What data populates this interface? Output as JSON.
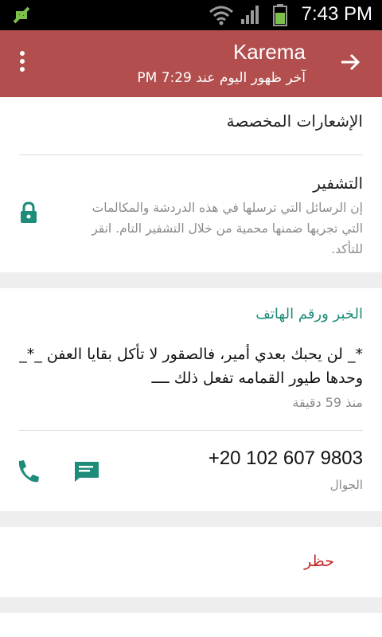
{
  "status_bar": {
    "time": "7:43 PM"
  },
  "header": {
    "name": "Karema",
    "last_seen": "آخر ظهور اليوم عند 7:29 PM"
  },
  "settings": {
    "custom_notifications": "الإشعارات المخصصة",
    "encryption_title": "التشفير",
    "encryption_desc": "إن الرسائل التي ترسلها في هذه الدردشة والمكالمات التي تجريها ضمنها محمية من خلال التشفير التام. انقر للتأكد."
  },
  "about": {
    "section_title": "الخبر ورقم الهاتف",
    "status": "*_ لن  يحبك بعدي أمير، فالصقور لا تأكل بقايا العفن _*_  وحدها طيور القمامه تفعل ذلك ــــ",
    "status_time": "منذ 59 دقيقة",
    "phone": "+20 102 607 9803",
    "phone_label": "الجوال"
  },
  "actions": {
    "block": "حظر"
  },
  "colors": {
    "appbar": "#b24e4e",
    "accent": "#1d8c78",
    "danger": "#c62828"
  }
}
